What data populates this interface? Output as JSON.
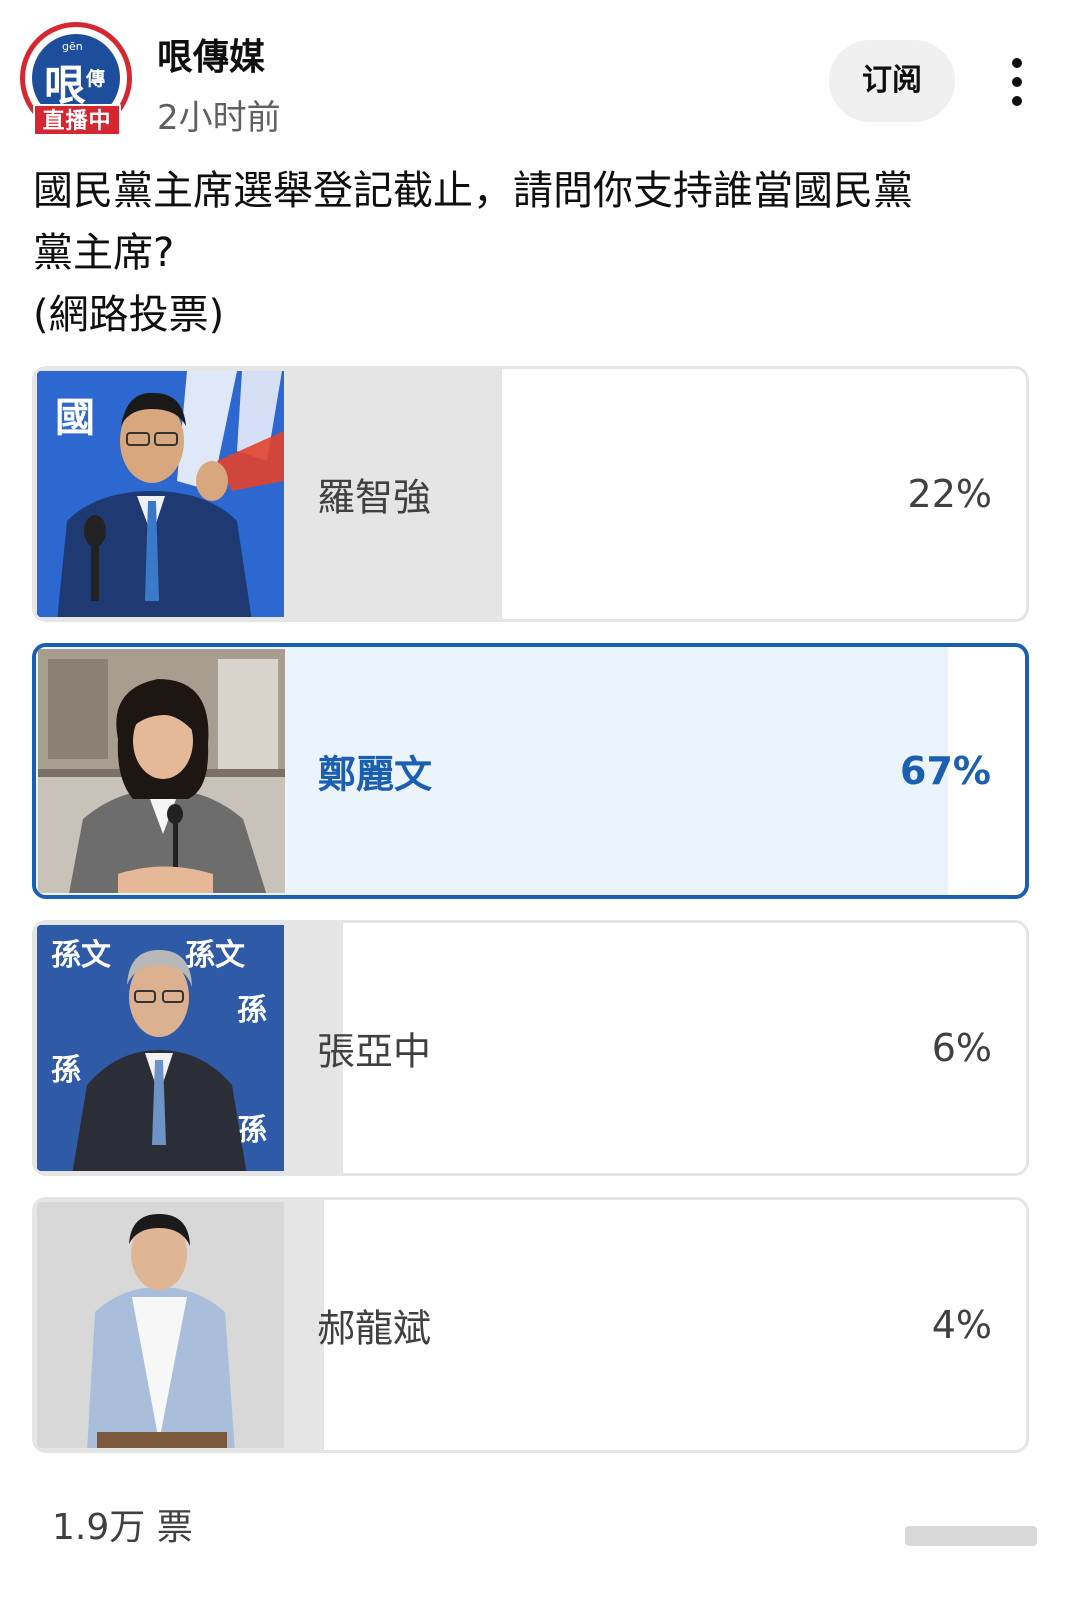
{
  "channel": {
    "name": "哏傳媒",
    "posted": "2小时前",
    "logo_text": "哏",
    "logo_side_text": "傳",
    "logo_mini_text": "gēn",
    "live_badge": "直播中",
    "subscribe_label": "订阅"
  },
  "poll": {
    "question_line1": "國民黨主席選舉登記截止，請問你支持誰當國民黨",
    "question_line2": "黨主席?",
    "question_line3": "(網路投票)",
    "options": [
      {
        "name": "羅智強",
        "percent_label": "22%",
        "percent": 22,
        "selected": false
      },
      {
        "name": "鄭麗文",
        "percent_label": "67%",
        "percent": 67,
        "selected": true
      },
      {
        "name": "張亞中",
        "percent_label": "6%",
        "percent": 6,
        "selected": false
      },
      {
        "name": "郝龍斌",
        "percent_label": "4%",
        "percent": 4,
        "selected": false
      }
    ],
    "vote_count": "1.9万 票"
  },
  "colors": {
    "accent": "#1b5fb0",
    "selected_fill": "#ebf3fb",
    "bar_fill": "#e5e5e5",
    "brand_red": "#d62631",
    "brand_blue": "#1c4e9c"
  },
  "icons": {
    "more": "more-vertical-icon"
  }
}
